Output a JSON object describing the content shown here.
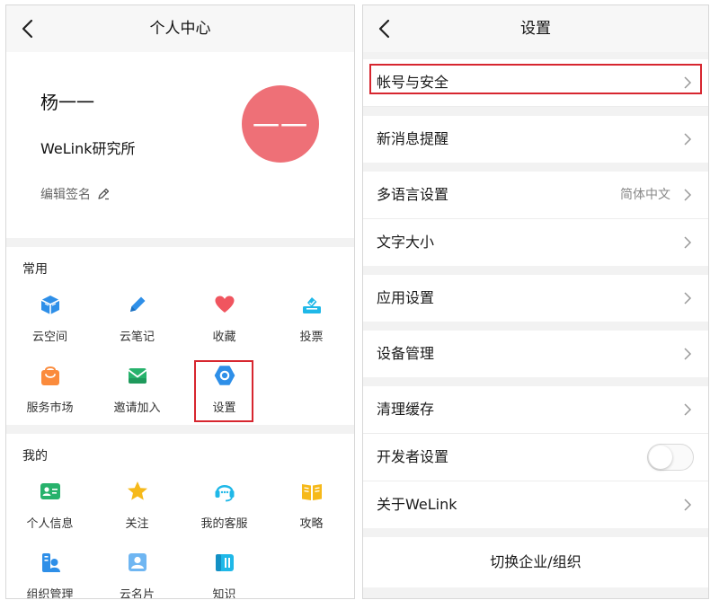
{
  "left": {
    "title": "个人中心",
    "profile": {
      "name": "杨一一",
      "org": "WeLink研究所",
      "sign_label": "编辑签名",
      "avatar_text": "一一",
      "avatar_color": "#ee7077"
    },
    "common": {
      "title": "常用",
      "items": [
        {
          "label": "云空间",
          "icon": "cloud-box-icon"
        },
        {
          "label": "云笔记",
          "icon": "pen-icon"
        },
        {
          "label": "收藏",
          "icon": "heart-icon"
        },
        {
          "label": "投票",
          "icon": "vote-box-icon"
        },
        {
          "label": "服务市场",
          "icon": "shopping-bag-icon"
        },
        {
          "label": "邀请加入",
          "icon": "envelope-icon"
        },
        {
          "label": "设置",
          "icon": "settings-hexagon-icon"
        }
      ]
    },
    "mine": {
      "title": "我的",
      "items": [
        {
          "label": "个人信息",
          "icon": "id-card-icon"
        },
        {
          "label": "关注",
          "icon": "star-icon"
        },
        {
          "label": "我的客服",
          "icon": "headset-icon"
        },
        {
          "label": "攻略",
          "icon": "book-icon"
        },
        {
          "label": "组织管理",
          "icon": "org-user-icon"
        },
        {
          "label": "云名片",
          "icon": "contact-card-icon"
        },
        {
          "label": "知识",
          "icon": "knowledge-icon"
        }
      ]
    }
  },
  "right": {
    "title": "设置",
    "groups": [
      [
        {
          "label": "帐号与安全"
        }
      ],
      [
        {
          "label": "新消息提醒"
        }
      ],
      [
        {
          "label": "多语言设置",
          "value": "简体中文"
        },
        {
          "label": "文字大小"
        }
      ],
      [
        {
          "label": "应用设置"
        }
      ],
      [
        {
          "label": "设备管理"
        }
      ],
      [
        {
          "label": "清理缓存"
        },
        {
          "label": "开发者设置",
          "toggle": false
        },
        {
          "label": "关于WeLink"
        }
      ]
    ],
    "switch_label": "切换企业/组织"
  },
  "colors": {
    "highlight": "#d7262f",
    "icon_blue": "#2e8fe8",
    "icon_cyan": "#1fb8e8",
    "icon_red": "#f0555f",
    "icon_orange": "#fb8b3c",
    "icon_green": "#27b26c",
    "icon_yellow": "#f6b91a"
  }
}
